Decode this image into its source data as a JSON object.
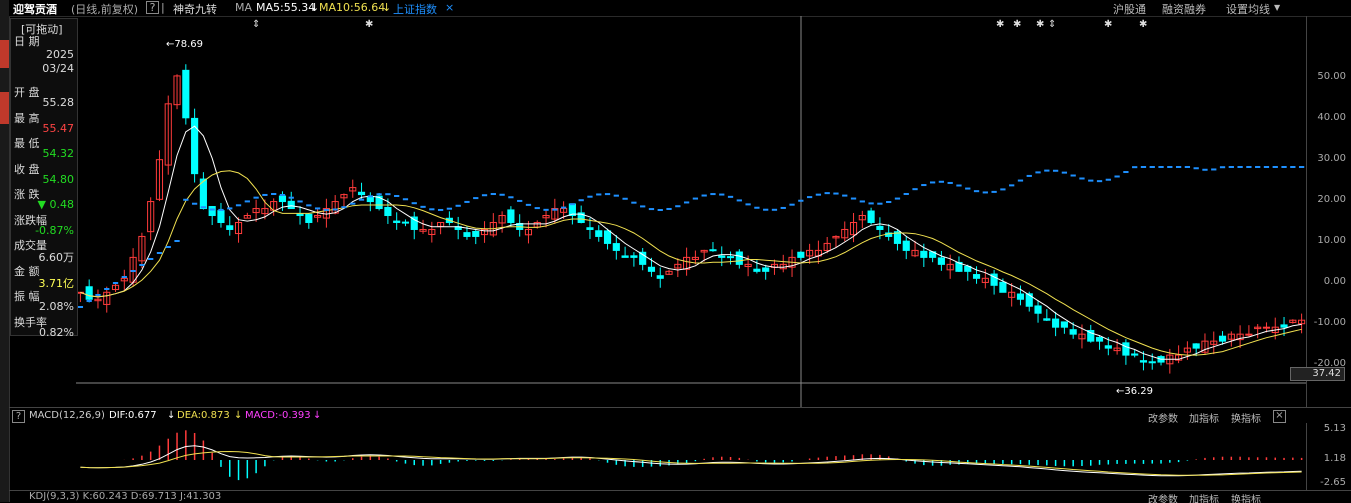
{
  "header": {
    "stock_name": "迎驾贡酒",
    "period": "(日线,前复权)",
    "help": "?",
    "pattern": "神奇九转",
    "ma_label": "MA",
    "ma5": "MA5:55.34",
    "ma10": "MA10:56.64",
    "overlay_index": "上证指数",
    "close_x": "×",
    "right_links": [
      "沪股通",
      "融资融券",
      "设置均线"
    ]
  },
  "info_panel": {
    "movable": "[可拖动]",
    "rows": [
      {
        "label": "日 期",
        "value": "2025"
      },
      {
        "label": "",
        "value": "03/24"
      },
      {
        "label": "开 盘",
        "value": "55.28"
      },
      {
        "label": "最 高",
        "value": "55.47"
      },
      {
        "label": "最 低",
        "value": "54.32"
      },
      {
        "label": "收 盘",
        "value": "54.80"
      },
      {
        "label": "涨 跌",
        "value": "▼ 0.48"
      },
      {
        "label": "涨跌幅",
        "value": "-0.87%"
      },
      {
        "label": "成交量",
        "value": "6.60万"
      },
      {
        "label": "金 额",
        "value": "3.71亿"
      },
      {
        "label": "振 幅",
        "value": "2.08%"
      },
      {
        "label": "换手率",
        "value": "0.82%"
      }
    ]
  },
  "colors": {
    "up": "#ff3b3b",
    "down": "#00ffff",
    "ma5": "#ffffff",
    "ma10": "#f0e050",
    "index": "#1e90ff",
    "magenta": "#ff40ff",
    "green": "#22dd22",
    "orange": "#ff9933"
  },
  "chart_data": {
    "type": "candlestick",
    "title": "迎驾贡酒 (日线,前复权)",
    "yaxis_ticks": [
      "50.00",
      "40.00",
      "30.00",
      "20.00",
      "10.00",
      "0.00",
      "-10.00",
      "-20.00"
    ],
    "current_price_tag": "37.42",
    "annotations": {
      "high": "78.69",
      "low": "36.29"
    },
    "approx_close_series": [
      47,
      46,
      46,
      47,
      48,
      49,
      52,
      55,
      60,
      66,
      74,
      78,
      72,
      64,
      59,
      58,
      57,
      56,
      57,
      58,
      59,
      59,
      60,
      60,
      59,
      58,
      57,
      58,
      59,
      60,
      61,
      62,
      61,
      60,
      59,
      58,
      57,
      57,
      56,
      56,
      56,
      57,
      57,
      56,
      55,
      55,
      56,
      57,
      58,
      57,
      56,
      56,
      57,
      58,
      59,
      59,
      58,
      57,
      56,
      55,
      54,
      53,
      52,
      52,
      51,
      50,
      49,
      50,
      51,
      52,
      52,
      53,
      53,
      52,
      52,
      51,
      51,
      50,
      50,
      51,
      51,
      52,
      52,
      53,
      53,
      54,
      55,
      56,
      57,
      58,
      57,
      56,
      55,
      54,
      53,
      53,
      52,
      52,
      51,
      51,
      50,
      50,
      49,
      49,
      48,
      47,
      47,
      46,
      45,
      44,
      43,
      42,
      42,
      41,
      41,
      40,
      40,
      39,
      39,
      38,
      38,
      37,
      37,
      37,
      38,
      38,
      39,
      39,
      40,
      40,
      40,
      41,
      41,
      41,
      42,
      42,
      42,
      42,
      43,
      43
    ]
  },
  "macd": {
    "help": "?",
    "name": "MACD(12,26,9)",
    "dif": "DIF:0.677",
    "dea": "DEA:0.873",
    "macd": "MACD:-0.393",
    "buttons": [
      "改参数",
      "加指标",
      "换指标"
    ],
    "close_x": "×",
    "yaxis_ticks": [
      "5.13",
      "1.18",
      "-2.65"
    ]
  },
  "bottom_indicator": {
    "text": "KDJ(9,3,3)  K:60.243  D:69.713  J:41.303",
    "buttons": [
      "改参数",
      "加指标",
      "换指标"
    ]
  }
}
